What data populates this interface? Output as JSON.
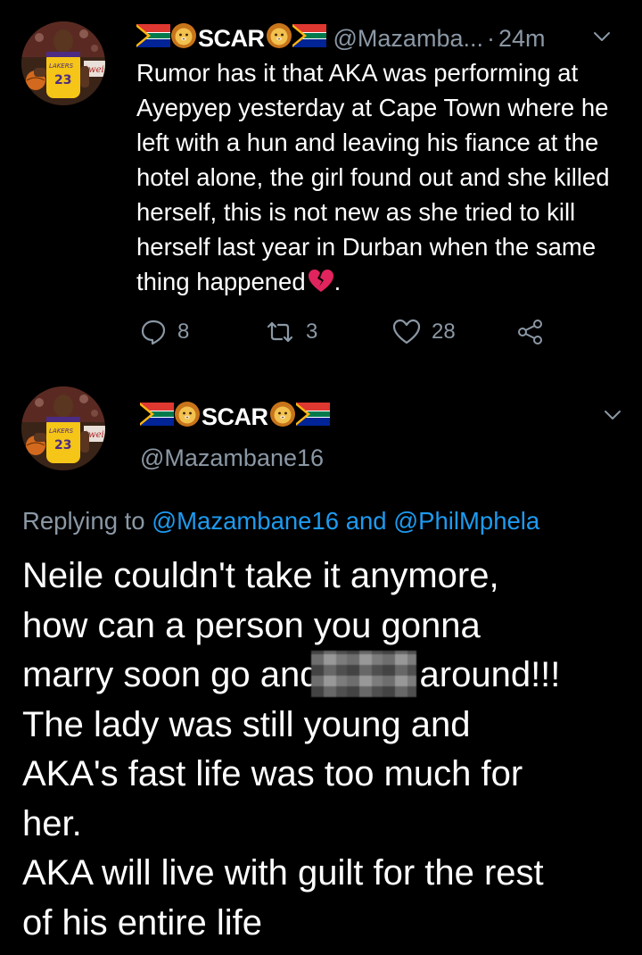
{
  "tweet1": {
    "display_name": "SCAR",
    "handle": "@Mazamba...",
    "separator": "·",
    "time": "24m",
    "body_text": "Rumor has it that AKA was performing at Ayepyep yesterday at Cape Town where he left with a hun and leaving his fiance at the hotel alone, the girl found out and she killed herself, this is not new as she tried to kill herself last year in Durban when the same thing happened",
    "body_end": ".",
    "emoji_end": "broken-heart-icon",
    "avatar_jersey_number": "23",
    "avatar_jersey_text": "LAKERS",
    "actions": {
      "reply_count": "8",
      "retweet_count": "3",
      "like_count": "28"
    }
  },
  "tweet2": {
    "display_name": "SCAR",
    "handle": "@Mazambane16",
    "avatar_jersey_number": "23",
    "avatar_jersey_text": "LAKERS",
    "replying_prefix": "Replying to",
    "replying_user1": "@Mazambane16",
    "replying_and": "and",
    "replying_user2": "@PhilMphela",
    "line1": "Neile couldn't take it anymore,",
    "line2": "how can a person you gonna",
    "line3_before": "marry soon go and",
    "line3_after": "around!!!",
    "line4": "The lady was still young and",
    "line5": "AKA's fast life was too much for",
    "line6": "her.",
    "line7": "AKA will live with guilt for the rest",
    "line8": "of his entire life"
  },
  "colors": {
    "background": "#000000",
    "text_primary": "#ffffff",
    "text_secondary": "#8b98a5",
    "link": "#1d9bf0"
  }
}
